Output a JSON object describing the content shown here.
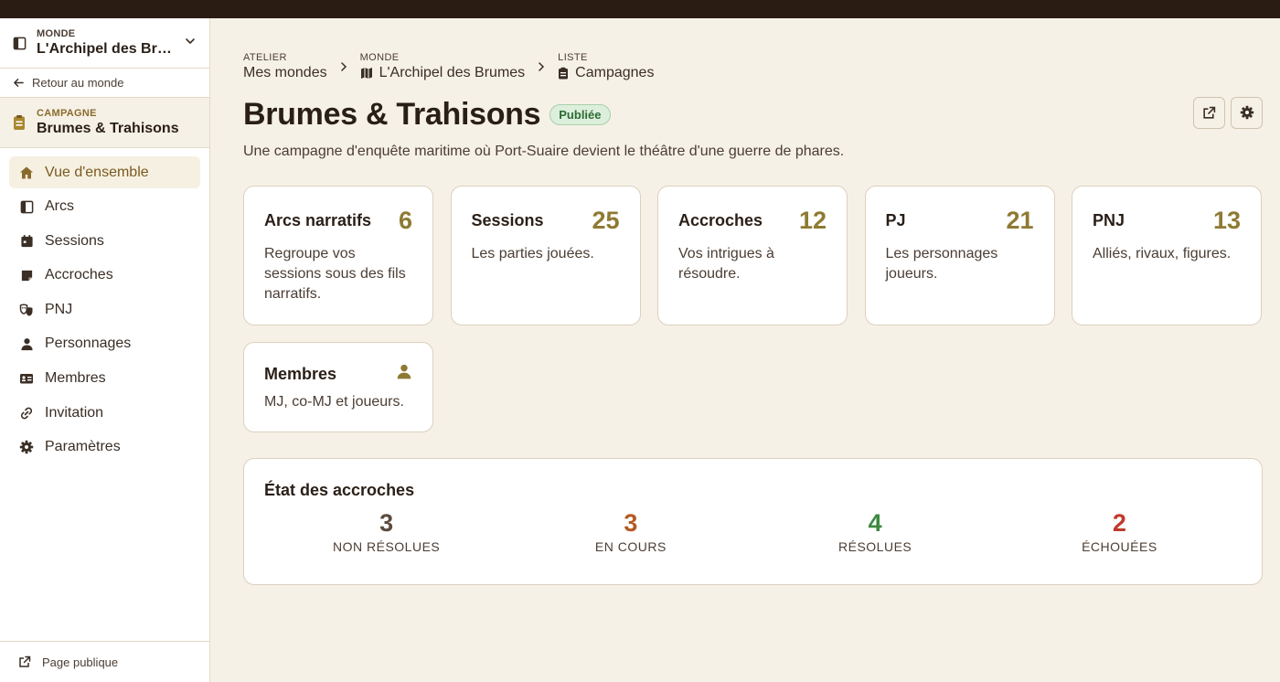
{
  "sidebar": {
    "world_label": "MONDE",
    "world_name": "L'Archipel des Brumes",
    "back_label": "Retour au monde",
    "campaign_label": "CAMPAGNE",
    "campaign_name": "Brumes & Trahisons",
    "items": [
      {
        "label": "Vue d'ensemble",
        "icon": "home-icon",
        "active": true
      },
      {
        "label": "Arcs",
        "icon": "book-icon"
      },
      {
        "label": "Sessions",
        "icon": "calendar-icon"
      },
      {
        "label": "Accroches",
        "icon": "sticky-note-icon"
      },
      {
        "label": "PNJ",
        "icon": "masks-icon"
      },
      {
        "label": "Personnages",
        "icon": "person-icon"
      },
      {
        "label": "Membres",
        "icon": "id-card-icon"
      },
      {
        "label": "Invitation",
        "icon": "link-icon"
      },
      {
        "label": "Paramètres",
        "icon": "gear-icon"
      }
    ],
    "footer_label": "Page publique"
  },
  "breadcrumb": [
    {
      "label": "ATELIER",
      "value": "Mes mondes"
    },
    {
      "label": "MONDE",
      "value": "L'Archipel des Brumes",
      "icon": "map-icon"
    },
    {
      "label": "LISTE",
      "value": "Campagnes",
      "icon": "clipboard-icon"
    }
  ],
  "page": {
    "title": "Brumes & Trahisons",
    "status_badge": "Publiée",
    "subtitle": "Une campagne d'enquête maritime où Port-Suaire devient le théâtre d'une guerre de phares."
  },
  "cards": [
    {
      "title": "Arcs narratifs",
      "count": "6",
      "desc": "Regroupe vos sessions sous des fils narratifs."
    },
    {
      "title": "Sessions",
      "count": "25",
      "desc": "Les parties jouées."
    },
    {
      "title": "Accroches",
      "count": "12",
      "desc": "Vos intrigues à résoudre."
    },
    {
      "title": "PJ",
      "count": "21",
      "desc": "Les personnages joueurs."
    },
    {
      "title": "PNJ",
      "count": "13",
      "desc": "Alliés, rivaux, figures."
    },
    {
      "title": "Membres",
      "icon": "person-icon",
      "desc": "MJ, co-MJ et joueurs."
    }
  ],
  "status": {
    "title": "État des accroches",
    "items": [
      {
        "value": "3",
        "label": "NON RÉSOLUES",
        "color": "#5a4b3e"
      },
      {
        "value": "3",
        "label": "EN COURS",
        "color": "#b35a1f"
      },
      {
        "value": "4",
        "label": "RÉSOLUES",
        "color": "#3d8a3f"
      },
      {
        "value": "2",
        "label": "ÉCHOUÉES",
        "color": "#c0392b"
      }
    ]
  },
  "colors": {
    "accent": "#8f7a33",
    "background": "#f6f1e7",
    "topbar": "#2a1c13"
  }
}
